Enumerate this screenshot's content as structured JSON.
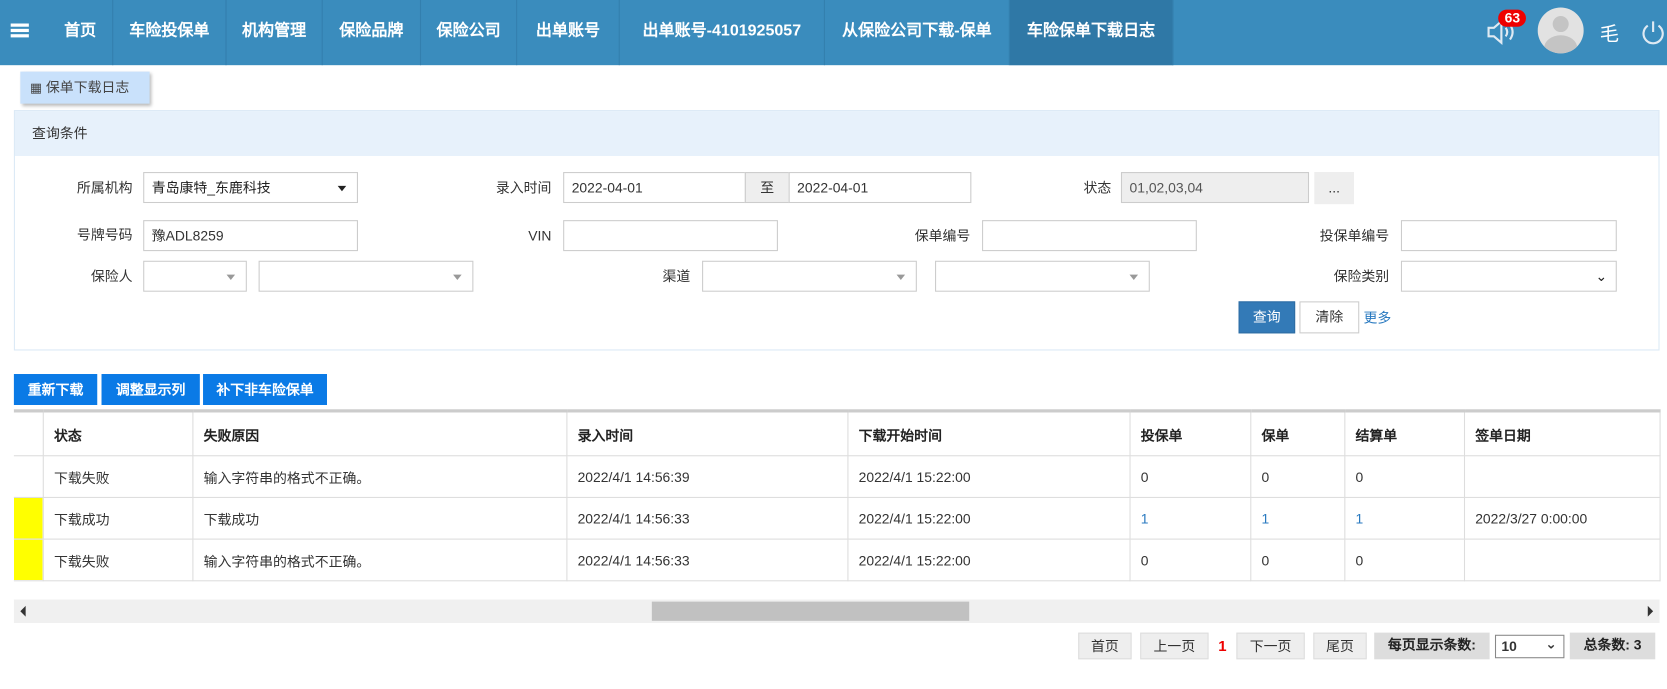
{
  "nav": {
    "items": [
      "首页",
      "车险投保单",
      "机构管理",
      "保险品牌",
      "保险公司",
      "出单账号",
      "出单账号-4101925057",
      "从保险公司下载-保单",
      "车险保单下载日志"
    ],
    "badge": "63",
    "user": "毛"
  },
  "breadcrumb": "保单下载日志",
  "query": {
    "title": "查询条件",
    "org_label": "所属机构",
    "org_value": "青岛康特_东鹿科技",
    "time_label": "录入时间",
    "time_from": "2022-04-01",
    "time_sep": "至",
    "time_to": "2022-04-01",
    "status_label": "状态",
    "status_value": "01,02,03,04",
    "status_btn": "...",
    "plate_label": "号牌号码",
    "plate_value": "豫ADL8259",
    "vin_label": "VIN",
    "policy_label": "保单编号",
    "proposal_label": "投保单编号",
    "insurer_label": "保险人",
    "channel_label": "渠道",
    "type_label": "保险类别",
    "search": "查询",
    "clear": "清除",
    "more": "更多"
  },
  "actions": [
    "重新下载",
    "调整显示列",
    "补下非车险保单"
  ],
  "table": {
    "headers": [
      "状态",
      "失败原因",
      "录入时间",
      "下载开始时间",
      "投保单",
      "保单",
      "结算单",
      "签单日期"
    ],
    "rows": [
      {
        "marked": false,
        "cells": [
          "下载失败",
          "输入字符串的格式不正确。",
          "2022/4/1 14:56:39",
          "2022/4/1 15:22:00",
          "0",
          "0",
          "0",
          ""
        ]
      },
      {
        "marked": true,
        "cells": [
          "下载成功",
          "下载成功",
          "2022/4/1 14:56:33",
          "2022/4/1 15:22:00",
          "1",
          "1",
          "1",
          "2022/3/27 0:00:00"
        ]
      },
      {
        "marked": true,
        "cells": [
          "下载失败",
          "输入字符串的格式不正确。",
          "2022/4/1 14:56:33",
          "2022/4/1 15:22:00",
          "0",
          "0",
          "0",
          ""
        ]
      }
    ]
  },
  "pagination": {
    "first": "首页",
    "prev": "上一页",
    "current": "1",
    "next": "下一页",
    "last": "尾页",
    "per_page_label": "每页显示条数:",
    "per_page": "10",
    "total": "总条数: 3"
  },
  "colors": {
    "header": "#3a8cbd",
    "action": "#0a7ae6",
    "marker": "#ffff00"
  }
}
